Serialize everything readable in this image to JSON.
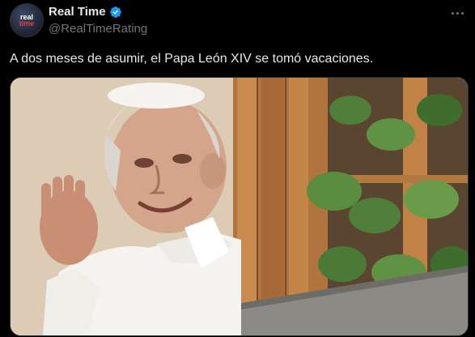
{
  "account": {
    "display_name": "Real Time",
    "handle": "@RealTimeRating",
    "avatar_text_top": "real",
    "avatar_text_bottom": "time",
    "verified": true
  },
  "tweet": {
    "text": "A dos meses de asumir, el Papa León XIV se tomó vacaciones."
  },
  "icons": {
    "verified": "verified-badge-icon",
    "more": "more-options-icon"
  },
  "colors": {
    "background": "#000000",
    "text": "#e7e9ea",
    "secondary_text": "#71767b",
    "verified_blue": "#1d9bf0",
    "border": "#2f3336"
  }
}
